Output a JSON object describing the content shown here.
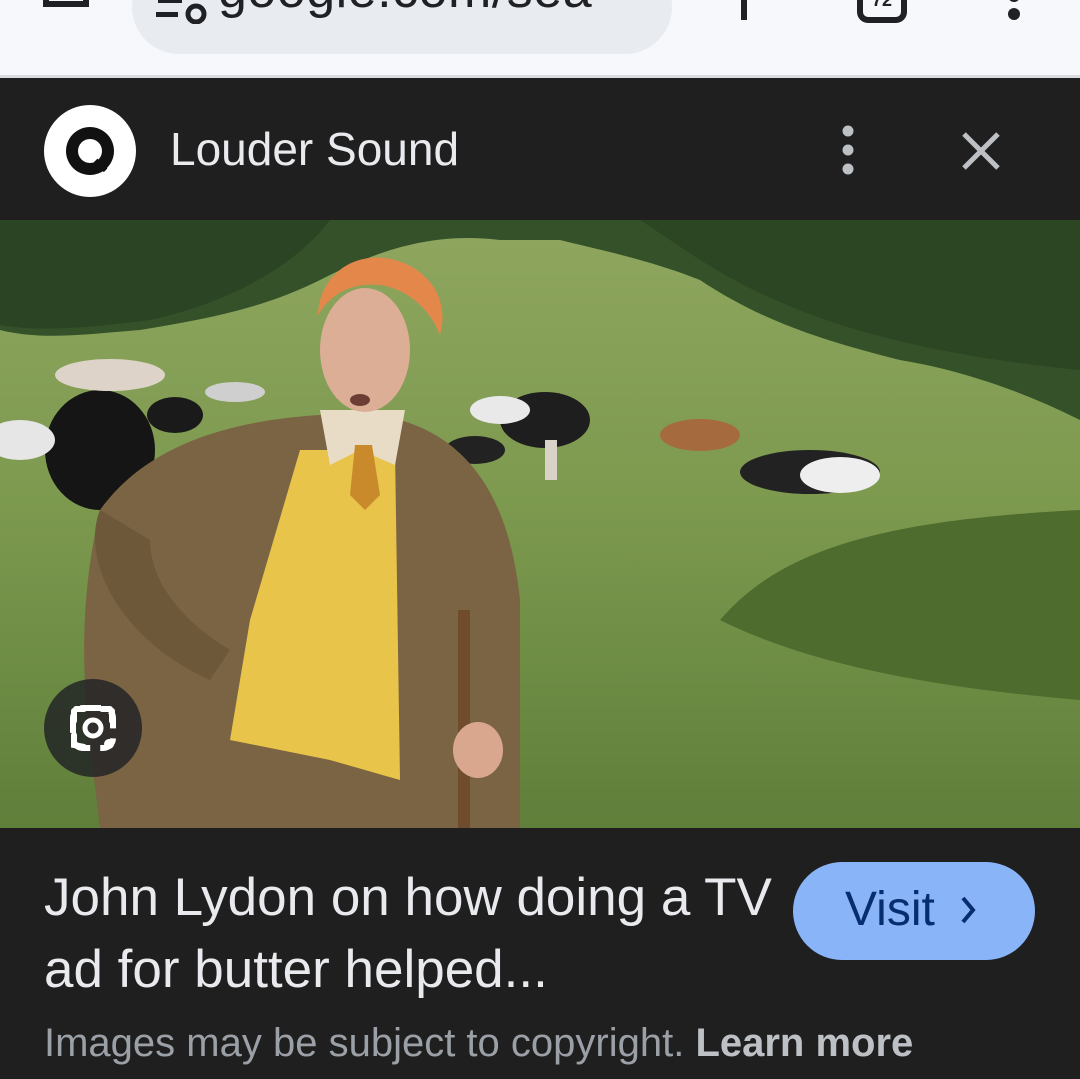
{
  "browser": {
    "url_text": "google.com/sea",
    "tab_count": "72",
    "icons": [
      "home-icon",
      "site-info-icon",
      "new-tab-icon",
      "tab-switcher-icon",
      "overflow-menu-icon"
    ]
  },
  "source": {
    "name": "Louder Sound",
    "icons": [
      "source-logo-icon",
      "more-vert-icon",
      "close-icon"
    ]
  },
  "image": {
    "icons": [
      "google-lens-icon"
    ]
  },
  "result": {
    "title": "John Lydon on how doing a TV ad for butter helped...",
    "visit_label": "Visit",
    "copyright_text": "Images may be subject to copyright.",
    "learn_more_label": "Learn more"
  },
  "colors": {
    "background": "#1f1f1f",
    "browser_bar": "#f6f8fc",
    "visit_button": "#8ab4f8",
    "visit_text": "#062e6f",
    "secondary_text": "#9aa0a6"
  }
}
